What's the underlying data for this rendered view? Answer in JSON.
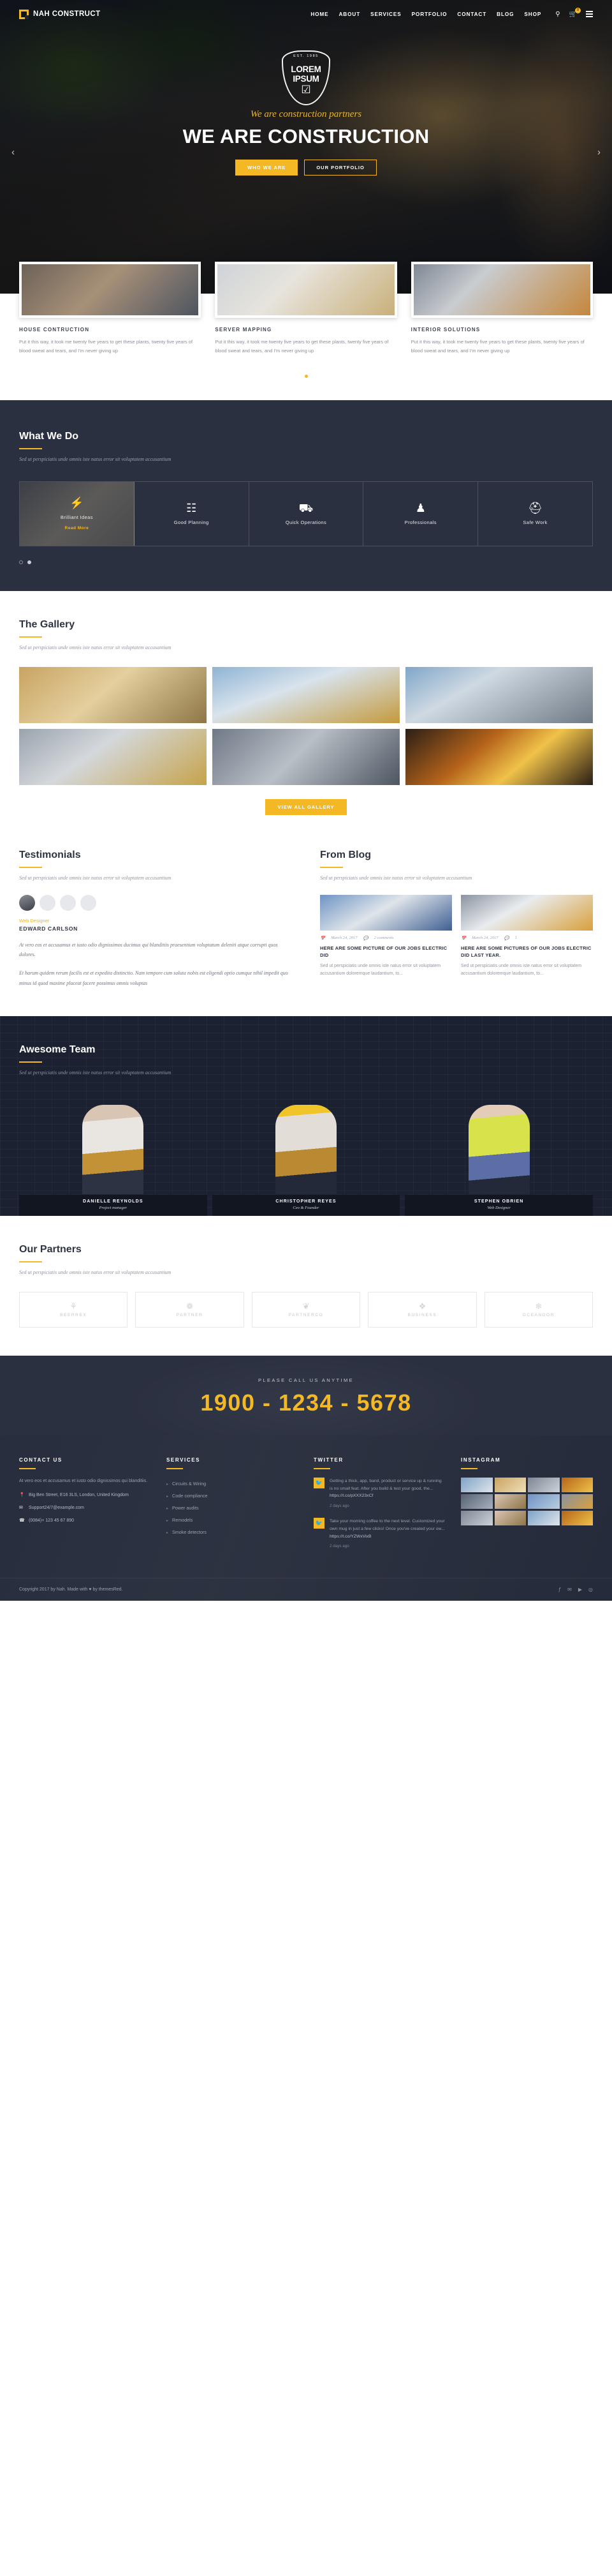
{
  "brand": {
    "name": "NAH CONSTRUCT",
    "accent": "#f3b823",
    "dark": "#2b3040"
  },
  "nav": {
    "items": [
      "HOME",
      "ABOUT",
      "SERVICES",
      "PORTFOLIO",
      "CONTACT",
      "BLOG",
      "SHOP"
    ],
    "search_icon": "search-icon",
    "cart_icon": "cart-icon",
    "cart_count": "0",
    "menu_icon": "hamburger-icon"
  },
  "hero": {
    "emblem_est": "EST. 1985",
    "emblem_name": "LOREM IPSUM",
    "emblem_icon": "☑",
    "tagline": "We are construction partners",
    "title": "WE ARE CONSTRUCTION",
    "btn_primary": "WHO WE ARE",
    "btn_secondary": "OUR PORTFOLIO",
    "arrow_prev": "‹",
    "arrow_next": "›"
  },
  "services": {
    "cards": [
      {
        "title": "HOUSE CONTRUCTION",
        "text": "Put it this way, it took me twenty five years to get these plants, twenty five years of blood sweat and tears, and I'm never giving up"
      },
      {
        "title": "SERVER MAPPING",
        "text": "Put it this way, it took me twenty five years to get these plants, twenty five years of blood sweat and tears, and I'm never giving up"
      },
      {
        "title": "INTERIOR SOLUTIONS",
        "text": "Put it this way, it took me twenty five years to get these plants, twenty five years of blood sweat and tears, and I'm never giving up"
      }
    ]
  },
  "what_we_do": {
    "title": "What We Do",
    "subtitle": "Sed ut perspiciatis unde omnis iste natus error sit voluptatem accusantium",
    "tiles": [
      {
        "label": "Brilliant Ideas",
        "icon": "lightbulb-icon",
        "glyph": "⚡",
        "more": "Read More",
        "active": true
      },
      {
        "label": "Good Planning",
        "icon": "building-icon",
        "glyph": "☷",
        "active": false
      },
      {
        "label": "Quick Operations",
        "icon": "truck-icon",
        "glyph": "⛟",
        "active": false
      },
      {
        "label": "Professionals",
        "icon": "worker-icon",
        "glyph": "♟",
        "active": false
      },
      {
        "label": "Safe Work",
        "icon": "helmet-icon",
        "glyph": "⛑",
        "active": false
      }
    ]
  },
  "gallery": {
    "title": "The Gallery",
    "subtitle": "Sed ut perspiciatis unde omnis iste natus error sit voluptatem accusantium",
    "button": "VIEW ALL GALLERY"
  },
  "testimonials": {
    "title": "Testimonials",
    "subtitle": "Sed ut perspiciatis unde omnis iste natus error sit voluptatem accusantium",
    "role": "Web Designer",
    "name": "EDWARD CARLSON",
    "quote1": "At vero eos et accusamus et iusto odio dignissimos ducimus qui blanditiis praesentium voluptatum deleniti atque corrupti quos dolores.",
    "quote2": "Et harum quidem rerum facilis est et expedita distinctio. Nam tempore cum soluta nobis est eligendi optio cumque nihil impedit quo minus id quod maxime placeat facere possimus omnis voluptas"
  },
  "blog": {
    "title": "From Blog",
    "subtitle": "Sed ut perspiciatis unde omnis iste natus error sit voluptatem accusantium",
    "posts": [
      {
        "date": "March 24, 2017",
        "comments": "2 comments",
        "title": "HERE ARE SOME PICTURE OF OUR JOBS ELECTRIC DID",
        "excerpt": "Sed ut perspiciatis unde omnis iste natus error sit voluptatem accusantium doloremque laudantium, to..."
      },
      {
        "date": "March 24, 2017",
        "comments": "1",
        "title": "HERE ARE SOME PICTURES OF OUR JOBS ELECTRIC DID LAST YEAR.",
        "excerpt": "Sed ut perspiciatis unde omnis iste natus error sit voluptatem accusantium doloremque laudantium, to..."
      }
    ]
  },
  "team": {
    "title": "Awesome Team",
    "subtitle": "Sed ut perspiciatis unde omnis iste natus error sit voluptatem accusantium",
    "members": [
      {
        "name": "DANIELLE REYNOLDS",
        "role": "Project manager"
      },
      {
        "name": "CHRISTOPHER REYES",
        "role": "Ceo & Founder"
      },
      {
        "name": "STEPHEN OBRIEN",
        "role": "Web Designer"
      }
    ]
  },
  "partners": {
    "title": "Our Partners",
    "subtitle": "Sed ut perspiciatis unde omnis iste natus error sit voluptatem accusantium",
    "items": [
      {
        "name": "BEERREX",
        "glyph": "⚘"
      },
      {
        "name": "PARTNER",
        "glyph": "❁"
      },
      {
        "name": "PARTNERCO",
        "glyph": "❦"
      },
      {
        "name": "BUSINESS",
        "glyph": "❖"
      },
      {
        "name": "OCEANDOR",
        "glyph": "❄"
      }
    ]
  },
  "call": {
    "kicker": "PLEASE CALL US ANYTIME",
    "number": "1900 - 1234 - 5678"
  },
  "footer": {
    "contact": {
      "heading": "CONTACT US",
      "desc": "At vero eos et accusamus et iusto odio dignissimos qui blanditiis.",
      "address": "Big Ben Street, E16 3LS, London, United Kingdom",
      "email": "Support24/7@example.com",
      "phone": "(0084)+ 123 45 67 890"
    },
    "services": {
      "heading": "SERVICES",
      "items": [
        "Circuits & Wiring",
        "Code compliance",
        "Power audits",
        "Remodels",
        "Smoke detectors"
      ]
    },
    "twitter": {
      "heading": "TWITTER",
      "tweets": [
        {
          "text": "Getting a thick, app, band, product or service up & running is no small feat. After you build & test your good, the...",
          "link": "https://t.co/pXXX23xCf",
          "time": "2 days ago"
        },
        {
          "text": "Take your morning coffee to the next level. Customized your own mug in just a few clicks! Once you've created your ow...",
          "link": "https://t.co/YZWxVixB",
          "time": "2 days ago"
        }
      ]
    },
    "instagram": {
      "heading": "INSTAGRAM"
    },
    "copyright": "Copyright 2017 by Nah. Made with ♥ by themesRed.",
    "social": [
      "ƒ",
      "✉",
      "▶",
      "◎"
    ]
  }
}
